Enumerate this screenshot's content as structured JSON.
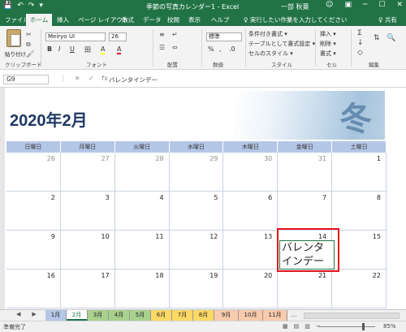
{
  "window": {
    "title": "季節の写真カレンダー1  -  Excel",
    "user": "一部 秋葉",
    "qat": [
      "💾",
      "↶",
      "↷",
      "▾"
    ],
    "controls": [
      "─",
      "☐",
      "✕"
    ],
    "user_icon": "☺",
    "ribbon_display_icon": "▣"
  },
  "ribbon_tabs": [
    "ファイル",
    "ホーム",
    "挿入",
    "ページ レイアウト",
    "数式",
    "データ",
    "校閲",
    "表示",
    "ヘルプ"
  ],
  "active_tab": "ホーム",
  "tell_me": "♀ 実行したい作業を入力してください",
  "share": "♀ 共有",
  "ribbon": {
    "groups": [
      "クリップボード",
      "フォント",
      "配置",
      "数値",
      "スタイル",
      "セル",
      "編集"
    ],
    "paste_label": "貼り付け",
    "font_name": "Meiryo UI",
    "font_size": "26",
    "font_buttons": [
      "B",
      "I",
      "U",
      "田",
      "A",
      "A"
    ],
    "number_format": "標準",
    "number_buttons": [
      "%",
      ",",
      ".0"
    ],
    "style_items": [
      "条件付き書式 ▾",
      "テーブルとして書式設定 ▾",
      "セルのスタイル ▾"
    ],
    "cell_items": [
      "挿入 ▾",
      "削除 ▾",
      "書式 ▾"
    ],
    "edit_icons": [
      "Σ",
      "↓",
      "◇",
      "🔍"
    ]
  },
  "formula_bar": {
    "name_box": "G9",
    "icons": [
      "⋮",
      "✕",
      "✓",
      "fx"
    ],
    "formula": "バレンタインデー"
  },
  "calendar": {
    "title": "2020年2月",
    "image_kanji": "冬",
    "day_headers": [
      "日曜日",
      "月曜日",
      "火曜日",
      "水曜日",
      "木曜日",
      "金曜日",
      "土曜日"
    ],
    "weeks": [
      [
        "26",
        "27",
        "28",
        "29",
        "30",
        "31",
        "1"
      ],
      [
        "2",
        "3",
        "4",
        "5",
        "6",
        "7",
        "8"
      ],
      [
        "9",
        "10",
        "11",
        "12",
        "13",
        "14",
        "15"
      ],
      [
        "16",
        "17",
        "18",
        "19",
        "20",
        "21",
        "22"
      ]
    ],
    "other_month_color": "#8c8c8c",
    "highlight_cell": {
      "week": 2,
      "day": 5
    },
    "note_lines": [
      "バレンタ",
      "インデー"
    ],
    "highlight_color": "#e8141c"
  },
  "sheet_tabs": [
    "1月",
    "2月",
    "3月",
    "4月",
    "5月",
    "6月",
    "7月",
    "8月",
    "9月",
    "10月",
    "11月"
  ],
  "active_sheet": "2月",
  "sheet_tab_colors": [
    "#b4c7e7",
    "#ffffff",
    "#a9d18e",
    "#a9d18e",
    "#a9d18e",
    "#ffd966",
    "#ffd966",
    "#ffd966",
    "#f8cbad",
    "#f8cbad",
    "#f8cbad"
  ],
  "sheet_nav": [
    "◀",
    "▶"
  ],
  "more_sheets": "…",
  "status": {
    "text": "準備完了",
    "views": [
      "▦",
      "▤",
      "▥"
    ],
    "zoom": "85%",
    "zoom_icons": [
      "−",
      "+"
    ]
  }
}
